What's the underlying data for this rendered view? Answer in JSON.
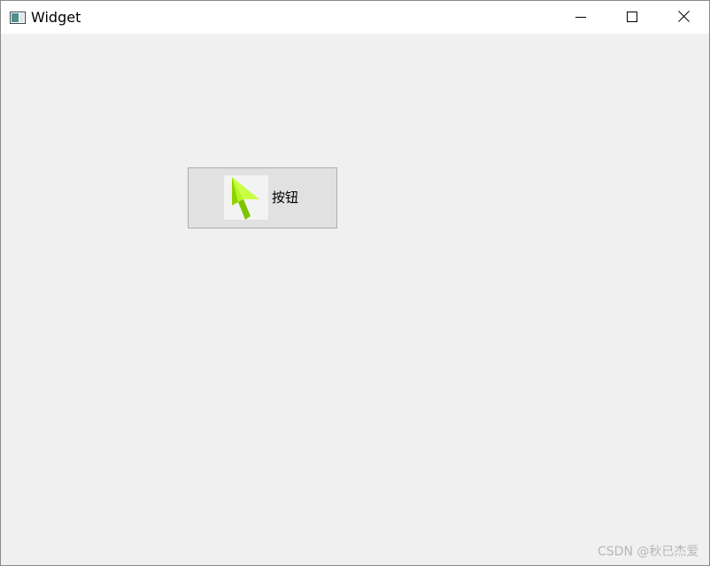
{
  "window": {
    "title": "Widget"
  },
  "titlebar_controls": {
    "minimize_icon": "minimize-icon",
    "maximize_icon": "maximize-icon",
    "close_icon": "close-icon"
  },
  "button": {
    "label": "按钮",
    "icon": "cursor-arrow-icon",
    "icon_color": "#a6e22e"
  },
  "watermark": {
    "text": "CSDN @秋已杰爱"
  },
  "colors": {
    "window_bg": "#f0f0f0",
    "titlebar_bg": "#ffffff",
    "button_bg": "#e1e1e1",
    "button_border": "#adadad"
  }
}
